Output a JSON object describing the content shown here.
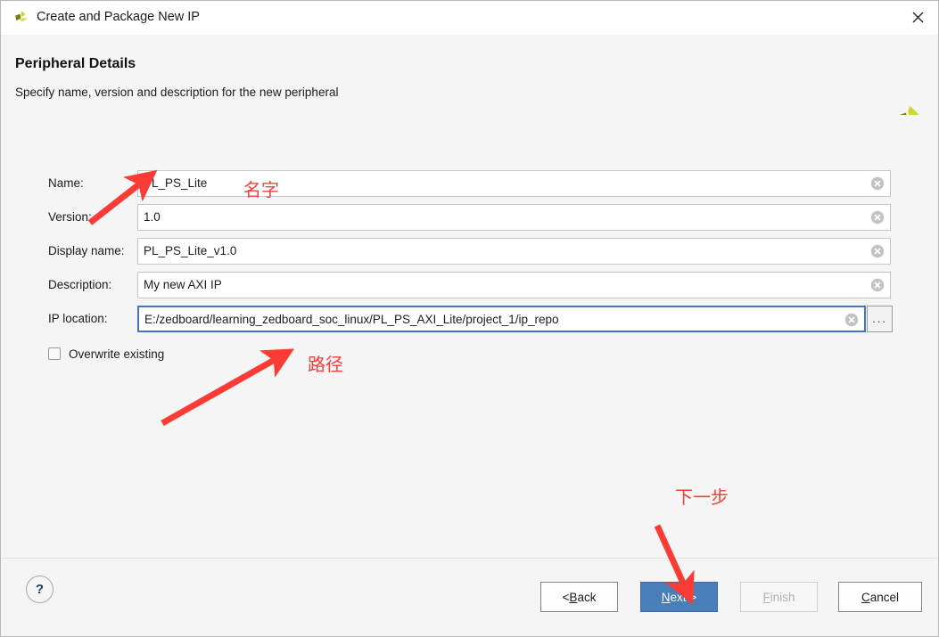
{
  "window": {
    "title": "Create and Package New IP",
    "logo_icon": "vivado-logo-icon",
    "close_icon": "close-icon"
  },
  "header": {
    "title": "Peripheral Details",
    "subtitle": "Specify name, version and description for the new peripheral",
    "logo_icon": "vivado-logo-large-icon"
  },
  "form": {
    "fields": [
      {
        "label": "Name:",
        "value": "PL_PS_Lite",
        "clear_icon": "clear-field-icon",
        "focused": false
      },
      {
        "label": "Version:",
        "value": "1.0",
        "clear_icon": "clear-field-icon",
        "focused": false
      },
      {
        "label": "Display name:",
        "value": "PL_PS_Lite_v1.0",
        "clear_icon": "clear-field-icon",
        "focused": false
      },
      {
        "label": "Description:",
        "value": "My new AXI IP",
        "clear_icon": "clear-field-icon",
        "focused": false
      },
      {
        "label": "IP location:",
        "value": "E:/zedboard/learning_zedboard_soc_linux/PL_PS_AXI_Lite/project_1/ip_repo",
        "clear_icon": "clear-field-icon",
        "focused": true
      }
    ],
    "browse_label": "...",
    "overwrite": {
      "label": "Overwrite existing",
      "checked": false
    }
  },
  "footer": {
    "help_label": "?",
    "buttons": [
      {
        "name": "back",
        "prefix": "< ",
        "mnemonic": "B",
        "suffix": "ack",
        "style": "normal"
      },
      {
        "name": "next",
        "prefix": "",
        "mnemonic": "N",
        "suffix": "ext >",
        "style": "primary"
      },
      {
        "name": "finish",
        "prefix": "",
        "mnemonic": "F",
        "suffix": "inish",
        "style": "disabled"
      },
      {
        "name": "cancel",
        "prefix": "",
        "mnemonic": "C",
        "suffix": "ancel",
        "style": "normal"
      }
    ]
  },
  "annotations": {
    "color": "#f4403c",
    "name_label": "名字",
    "path_label": "路径",
    "next_label": "下一步"
  }
}
